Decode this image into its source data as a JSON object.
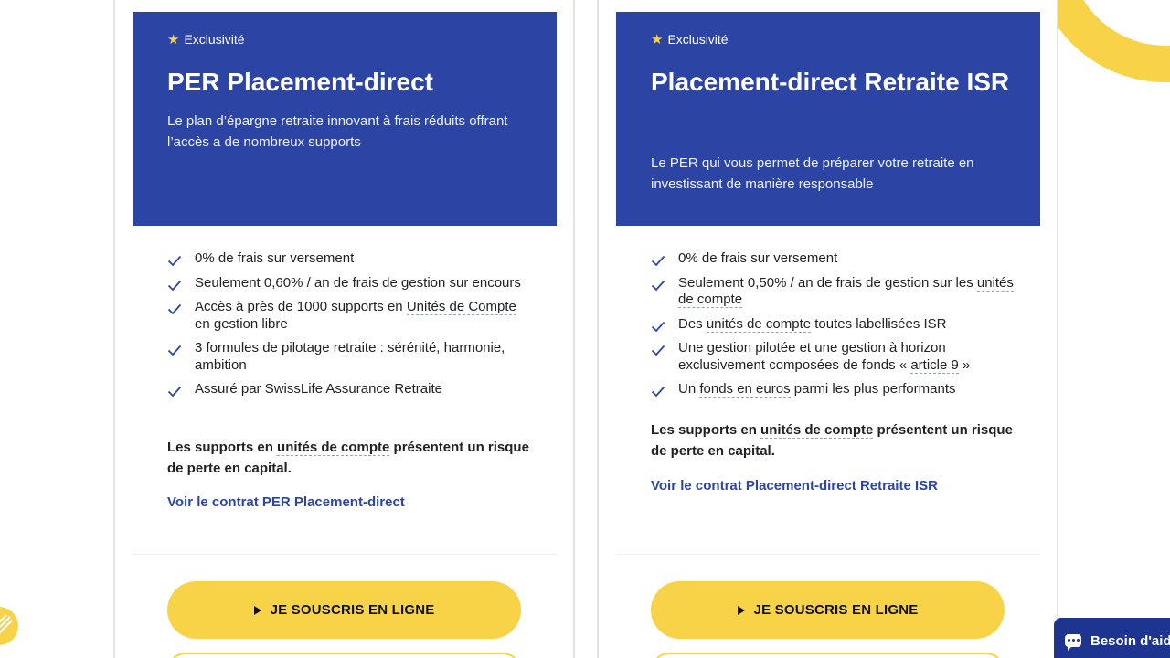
{
  "cards": [
    {
      "badge": "Exclusivité",
      "title": "PER Placement-direct",
      "description": "Le plan d’épargne retraite innovant à frais réduits offrant l’accès a de nombreux supports",
      "features": {
        "f1": "0% de frais sur versement",
        "f2": "Seulement 0,60% / an de frais de gestion sur encours",
        "f3_a": "Accès à près de 1000 supports en ",
        "f3_link": "Unités de Compte",
        "f3_b": " en gestion libre",
        "f4": "3 formules de pilotage retraite : sérénité, harmonie, ambition",
        "f5": "Assuré par SwissLife Assurance Retraite"
      },
      "risk_a": "Les supports en ",
      "risk_link": "unités de compte",
      "risk_b": " présentent un risque de perte en capital.",
      "contract_link": "Voir le contrat PER Placement-direct",
      "cta": "JE SOUSCRIS EN LIGNE"
    },
    {
      "badge": "Exclusivité",
      "title": "Placement-direct Retraite ISR",
      "description": "Le PER qui vous permet de préparer votre retraite en investissant de manière responsable",
      "features": {
        "f1": "0% de frais sur versement",
        "f2_a": "Seulement 0,50% / an de frais de gestion sur les ",
        "f2_link": "unités de compte",
        "f3_a": "Des ",
        "f3_link": "unités de compte",
        "f3_b": " toutes labellisées ISR",
        "f4_a": "Une gestion pilotée et une gestion à horizon exclusivement composées de fonds « ",
        "f4_link": "article 9",
        "f4_b": " »",
        "f5_a": "Un ",
        "f5_link": "fonds en euros",
        "f5_b": " parmi les plus performants"
      },
      "risk_a": "Les supports en ",
      "risk_link": "unités de compte",
      "risk_b": " présentent un risque de perte en capital.",
      "contract_link": "Voir le contrat Placement-direct Retraite ISR",
      "cta": "JE SOUSCRIS EN LIGNE"
    }
  ],
  "chat": {
    "label": "Besoin d'aide"
  },
  "colors": {
    "primary_blue": "#2c44a4",
    "accent_yellow": "#f8d347",
    "chat_blue": "#1e3491"
  },
  "icons": {
    "badge": "star-icon",
    "feature": "check-icon",
    "cta": "play-icon",
    "chat": "chat-bubble-icon"
  }
}
